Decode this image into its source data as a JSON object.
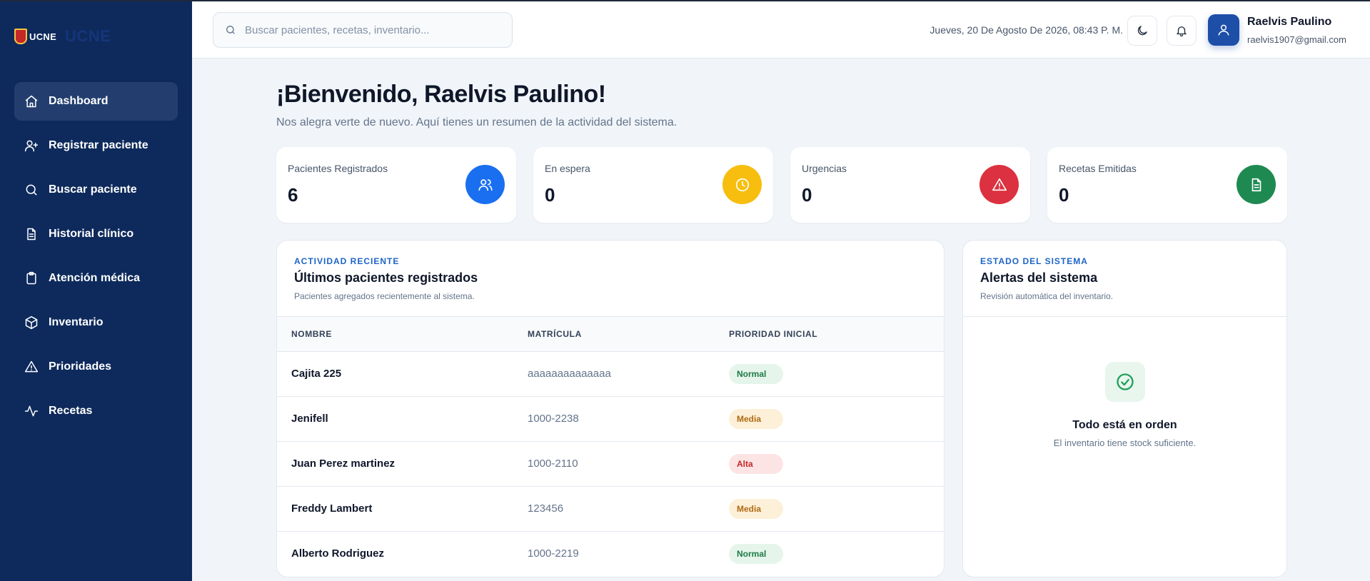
{
  "brand": {
    "logo_small": "UCNE",
    "logo_big": "UCNE"
  },
  "sidebar": {
    "items": [
      {
        "label": "Dashboard",
        "icon": "home-icon",
        "active": true
      },
      {
        "label": "Registrar paciente",
        "icon": "user-plus-icon"
      },
      {
        "label": "Buscar paciente",
        "icon": "search-icon"
      },
      {
        "label": "Historial clínico",
        "icon": "file-text-icon"
      },
      {
        "label": "Atención médica",
        "icon": "clipboard-icon"
      },
      {
        "label": "Inventario",
        "icon": "package-icon"
      },
      {
        "label": "Prioridades",
        "icon": "alert-triangle-icon"
      },
      {
        "label": "Recetas",
        "icon": "activity-icon"
      }
    ]
  },
  "header": {
    "search_placeholder": "Buscar pacientes, recetas, inventario...",
    "datetime": "Jueves, 20 De Agosto De 2026, 08:43 P. M.",
    "user": {
      "name": "Raelvis Paulino",
      "email": "raelvis1907@gmail.com"
    }
  },
  "welcome": {
    "title": "¡Bienvenido, Raelvis Paulino!",
    "subtitle": "Nos alegra verte de nuevo. Aquí tienes un resumen de la actividad del sistema."
  },
  "stats": [
    {
      "label": "Pacientes Registrados",
      "value": "6",
      "icon": "users-icon",
      "color": "#1a6ff0"
    },
    {
      "label": "En espera",
      "value": "0",
      "icon": "clock-icon",
      "color": "#f7be0f"
    },
    {
      "label": "Urgencias",
      "value": "0",
      "icon": "alert-triangle-icon",
      "color": "#dc3140"
    },
    {
      "label": "Recetas Emitidas",
      "value": "0",
      "icon": "file-text-icon",
      "color": "#1e8a52"
    }
  ],
  "recent": {
    "eyebrow": "ACTIVIDAD RECIENTE",
    "title": "Últimos pacientes registrados",
    "subtitle": "Pacientes agregados recientemente al sistema.",
    "columns": [
      "NOMBRE",
      "MATRÍCULA",
      "PRIORIDAD INICIAL"
    ],
    "rows": [
      {
        "nombre": "Cajita 225",
        "matricula": "aaaaaaaaaaaaaa",
        "prioridad": "Normal"
      },
      {
        "nombre": "Jenifell",
        "matricula": "1000-2238",
        "prioridad": "Media"
      },
      {
        "nombre": "Juan Perez martinez",
        "matricula": "1000-2110",
        "prioridad": "Alta"
      },
      {
        "nombre": "Freddy Lambert",
        "matricula": "123456",
        "prioridad": "Media"
      },
      {
        "nombre": "Alberto Rodriguez",
        "matricula": "1000-2219",
        "prioridad": "Normal"
      }
    ]
  },
  "system": {
    "eyebrow": "ESTADO DEL SISTEMA",
    "title": "Alertas del sistema",
    "subtitle": "Revisión automática del inventario.",
    "ok_title": "Todo está en orden",
    "ok_subtitle": "El inventario tiene stock suficiente."
  }
}
